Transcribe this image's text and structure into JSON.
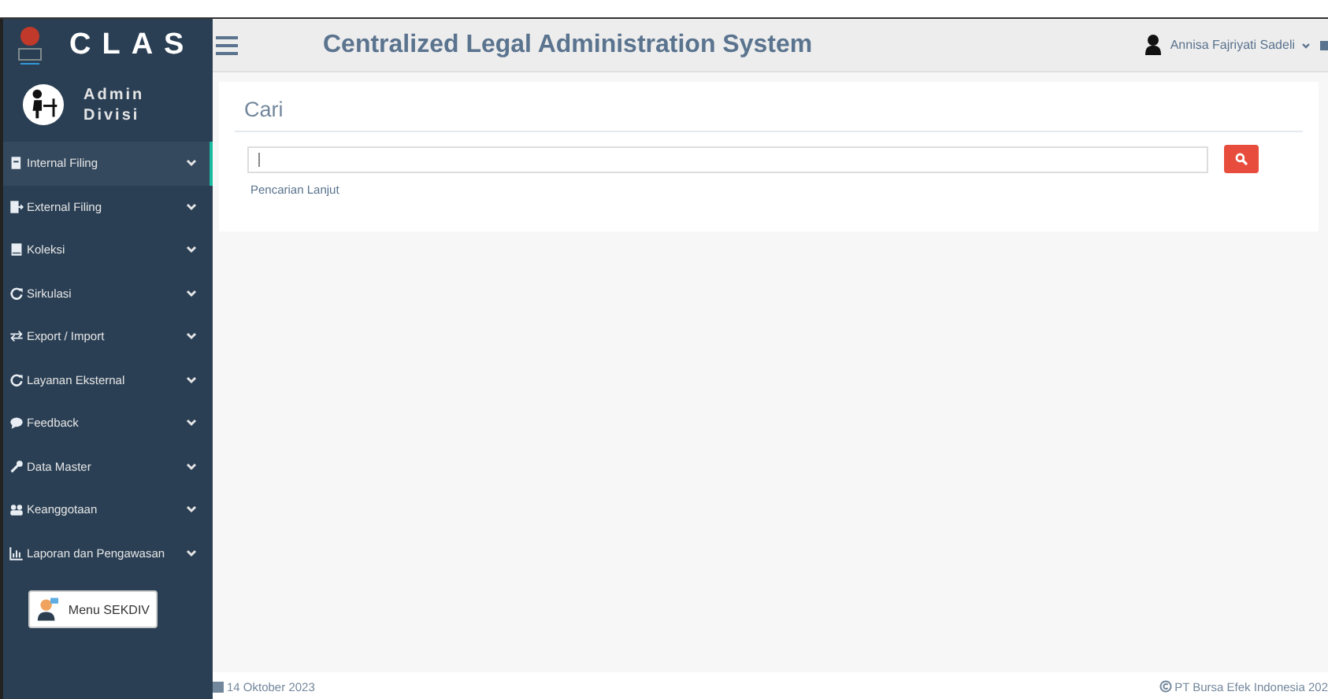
{
  "sidebar": {
    "brand": "CLAS",
    "user_label": "Admin Divisi",
    "items": [
      {
        "label": "Internal Filing",
        "selected": true
      },
      {
        "label": "External Filing",
        "selected": false
      },
      {
        "label": "Koleksi",
        "selected": false
      },
      {
        "label": "Sirkulasi",
        "selected": false
      },
      {
        "label": "Export / Import",
        "selected": false
      },
      {
        "label": "Layanan Eksternal",
        "selected": false
      },
      {
        "label": "Feedback",
        "selected": false
      },
      {
        "label": "Data Master",
        "selected": false
      },
      {
        "label": "Keanggotaan",
        "selected": false
      },
      {
        "label": "Laporan dan Pengawasan",
        "selected": false
      }
    ],
    "menu_button": "Menu SEKDIV"
  },
  "header": {
    "title": "Centralized Legal Administration System",
    "user": "Annisa Fajriyati Sadeli"
  },
  "search": {
    "title": "Cari",
    "advanced_link": "Pencarian Lanjut"
  },
  "footer": {
    "date": "14 Oktober 2023",
    "copyright": "PT Bursa Efek Indonesia 202"
  }
}
